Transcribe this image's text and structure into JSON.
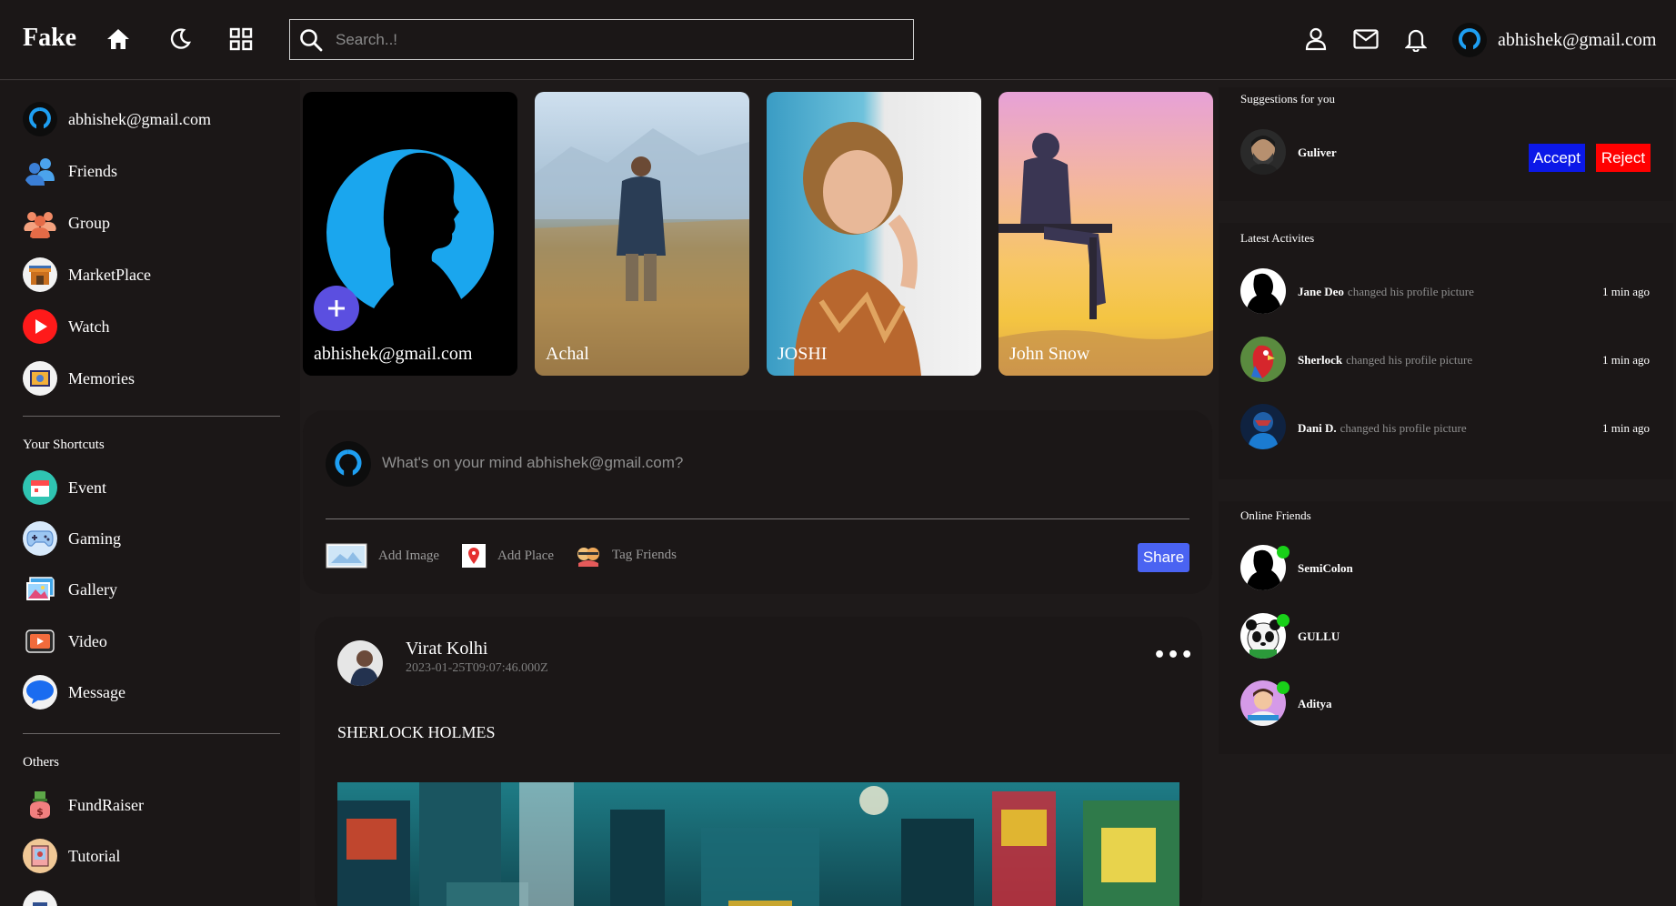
{
  "header": {
    "logo": "Fake",
    "search_placeholder": "Search..!",
    "user_email": "abhishek@gmail.com",
    "icons": [
      "home-icon",
      "moon-icon",
      "grid-icon",
      "user-icon",
      "mail-icon",
      "bell-icon"
    ]
  },
  "sidebar": {
    "profile_label": "abhishek@gmail.com",
    "main_items": [
      {
        "label": "Friends",
        "icon": "friends-icon"
      },
      {
        "label": "Group",
        "icon": "group-icon"
      },
      {
        "label": "MarketPlace",
        "icon": "marketplace-icon"
      },
      {
        "label": "Watch",
        "icon": "watch-icon"
      },
      {
        "label": "Memories",
        "icon": "memories-icon"
      }
    ],
    "shortcuts_title": "Your Shortcuts",
    "shortcut_items": [
      {
        "label": "Event",
        "icon": "event-icon"
      },
      {
        "label": "Gaming",
        "icon": "gaming-icon"
      },
      {
        "label": "Gallery",
        "icon": "gallery-icon"
      },
      {
        "label": "Video",
        "icon": "video-icon"
      },
      {
        "label": "Message",
        "icon": "message-icon"
      }
    ],
    "others_title": "Others",
    "other_items": [
      {
        "label": "FundRaiser",
        "icon": "fundraiser-icon"
      },
      {
        "label": "Tutorial",
        "icon": "tutorial-icon"
      }
    ]
  },
  "stories": [
    {
      "name": "abhishek@gmail.com"
    },
    {
      "name": "Achal"
    },
    {
      "name": "JOSHI"
    },
    {
      "name": "John Snow"
    }
  ],
  "composer": {
    "placeholder": "What's on your mind abhishek@gmail.com?",
    "add_image": "Add Image",
    "add_place": "Add Place",
    "tag_friends": "Tag Friends",
    "share": "Share"
  },
  "post": {
    "author": "Virat Kolhi",
    "timestamp": "2023-01-25T09:07:46.000Z",
    "text": "SHERLOCK HOLMES"
  },
  "suggestions": {
    "title": "Suggestions for you",
    "name": "Guliver",
    "accept": "Accept",
    "reject": "Reject"
  },
  "activities": {
    "title": "Latest Activites",
    "items": [
      {
        "name": "Jane Deo",
        "action": "changed his profile picture",
        "time": "1 min ago"
      },
      {
        "name": "Sherlock",
        "action": "changed his profile picture",
        "time": "1 min ago"
      },
      {
        "name": "Dani D.",
        "action": "changed his profile picture",
        "time": "1 min ago"
      }
    ]
  },
  "online": {
    "title": "Online Friends",
    "items": [
      {
        "name": "SemiColon"
      },
      {
        "name": "GULLU"
      },
      {
        "name": "Aditya"
      }
    ]
  },
  "colors": {
    "accent_blue": "#4a63f2",
    "accept_blue": "#0b18e8",
    "reject_red": "#ff0000",
    "online_green": "#19d119",
    "background": "#1e1a1a"
  }
}
